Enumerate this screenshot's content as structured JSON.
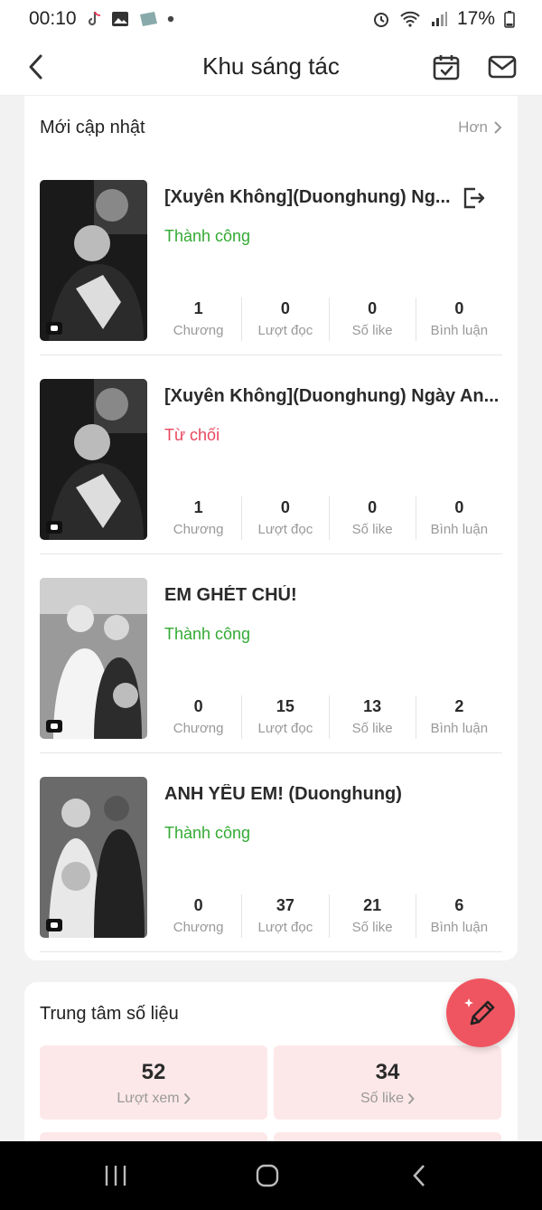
{
  "status_bar": {
    "time": "00:10",
    "battery": "17%"
  },
  "header": {
    "title": "Khu sáng tác"
  },
  "updates": {
    "section_title": "Mới cập nhật",
    "more_label": "Hơn",
    "items": [
      {
        "title": "[Xuyên Không](Duonghung) Ng...",
        "status": "Thành công",
        "chapters": "1",
        "reads": "0",
        "likes": "0",
        "comments": "0"
      },
      {
        "title": "[Xuyên Không](Duonghung) Ngày An...",
        "status": "Từ chối",
        "chapters": "1",
        "reads": "0",
        "likes": "0",
        "comments": "0"
      },
      {
        "title": "EM GHÉT CHÚ!",
        "status": "Thành công",
        "chapters": "0",
        "reads": "15",
        "likes": "13",
        "comments": "2"
      },
      {
        "title": "ANH YÊU EM! (Duonghung)",
        "status": "Thành công",
        "chapters": "0",
        "reads": "37",
        "likes": "21",
        "comments": "6"
      }
    ],
    "labels": {
      "chapters": "Chương",
      "reads": "Lượt đọc",
      "likes": "Số like",
      "comments": "Bình luận"
    }
  },
  "metrics": {
    "section_title": "Trung tâm số liệu",
    "views": {
      "value": "52",
      "label": "Lượt xem"
    },
    "likes": {
      "value": "34",
      "label": "Số like"
    }
  },
  "colors": {
    "success": "#33aa33",
    "rejected": "#e8465e",
    "accent": "#ef5560",
    "metric_bg": "#fde8e9"
  }
}
